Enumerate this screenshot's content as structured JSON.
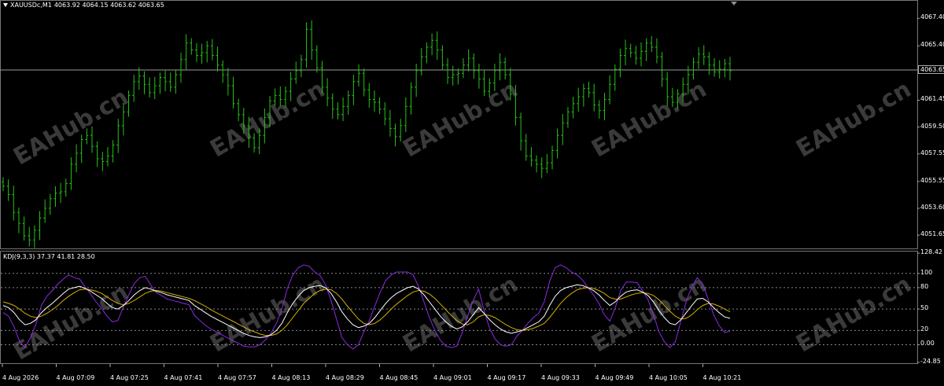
{
  "header": {
    "symbol": "XAUUSDc,M1",
    "ohlc": "4063.92 4064.15 4063.62 4063.65"
  },
  "indicator": {
    "title": "KDJ(9,3,3) 37.37 41.81 28.50"
  },
  "price_axis": {
    "ticks": [
      "4067.40",
      "4065.40",
      "4063.65",
      "4061.45",
      "4059.50",
      "4057.55",
      "4055.55",
      "4053.60",
      "4051.65"
    ],
    "current": "4063.65"
  },
  "indicator_axis": {
    "ticks": [
      "128.42",
      "100",
      "80",
      "50",
      "20",
      "0.00",
      "-24.85"
    ]
  },
  "time_axis": {
    "ticks": [
      "4 Aug 2026",
      "4 Aug 07:09",
      "4 Aug 07:25",
      "4 Aug 07:41",
      "4 Aug 07:57",
      "4 Aug 08:13",
      "4 Aug 08:29",
      "4 Aug 08:45",
      "4 Aug 09:01",
      "4 Aug 09:17",
      "4 Aug 09:33",
      "4 Aug 09:49",
      "4 Aug 10:05",
      "4 Aug 10:21"
    ]
  },
  "watermark": "EAHub.cn",
  "colors": {
    "candle": "#26c217",
    "k_line": "#ffffff",
    "d_line": "#d4b000",
    "j_line": "#8a2be2",
    "grid": "#888888"
  },
  "chart_data": {
    "type": "line",
    "price_range": [
      4050.8,
      4068.5
    ],
    "closes": [
      4055.2,
      4054.6,
      4053.3,
      4052.5,
      4051.6,
      4051.3,
      4052.0,
      4052.9,
      4053.6,
      4054.3,
      4054.7,
      4054.8,
      4055.4,
      4056.8,
      4057.6,
      4058.6,
      4058.9,
      4058.1,
      4057.2,
      4057.0,
      4057.4,
      4058.2,
      4059.6,
      4060.6,
      4061.8,
      4062.8,
      4063.2,
      4062.6,
      4062.0,
      4062.5,
      4063.1,
      4062.8,
      4062.4,
      4063.3,
      4064.4,
      4065.6,
      4065.1,
      4064.7,
      4064.9,
      4065.4,
      4064.7,
      4064.0,
      4063.3,
      4062.5,
      4061.2,
      4060.4,
      4059.6,
      4058.7,
      4058.0,
      4058.9,
      4060.2,
      4061.4,
      4061.8,
      4061.5,
      4062.1,
      4063.0,
      4063.6,
      4064.4,
      4066.6,
      4065.1,
      4063.8,
      4062.4,
      4061.6,
      4060.8,
      4060.4,
      4061.0,
      4061.8,
      4062.8,
      4063.4,
      4062.2,
      4061.5,
      4061.3,
      4060.8,
      4060.1,
      4059.4,
      4058.8,
      4059.6,
      4061.0,
      4062.4,
      4063.6,
      4064.6,
      4065.3,
      4065.8,
      4065.1,
      4064.0,
      4063.1,
      4063.3,
      4063.4,
      4064.0,
      4064.5,
      4063.6,
      4063.0,
      4062.1,
      4062.7,
      4063.6,
      4064.2,
      4063.3,
      4061.9,
      4060.2,
      4058.5,
      4057.4,
      4057.1,
      4056.8,
      4056.5,
      4056.9,
      4057.8,
      4058.9,
      4059.8,
      4060.6,
      4061.2,
      4061.7,
      4062.3,
      4062.0,
      4061.1,
      4060.7,
      4061.5,
      4062.6,
      4063.7,
      4064.7,
      4065.2,
      4064.9,
      4064.5,
      4065.0,
      4065.6,
      4065.3,
      4064.6,
      4063.0,
      4061.7,
      4061.3,
      4061.9,
      4062.6,
      4063.3,
      4064.2,
      4064.8,
      4064.6,
      4064.0,
      4063.5,
      4063.7,
      4064.1,
      4063.6
    ],
    "k_values": [
      55,
      52,
      45,
      35,
      28,
      30,
      35,
      45,
      52,
      58,
      65,
      72,
      78,
      80,
      82,
      79,
      75,
      70,
      65,
      58,
      52,
      50,
      55,
      62,
      70,
      76,
      80,
      78,
      75,
      73,
      70,
      68,
      66,
      64,
      62,
      55,
      50,
      45,
      40,
      36,
      32,
      28,
      24,
      20,
      16,
      13,
      11,
      10,
      11,
      14,
      20,
      30,
      45,
      58,
      68,
      76,
      80,
      82,
      83,
      80,
      72,
      60,
      46,
      36,
      28,
      24,
      26,
      30,
      38,
      48,
      58,
      66,
      72,
      76,
      80,
      82,
      78,
      70,
      60,
      50,
      40,
      32,
      26,
      22,
      25,
      32,
      42,
      52,
      44,
      35,
      28,
      22,
      18,
      16,
      18,
      20,
      24,
      28,
      32,
      40,
      55,
      68,
      76,
      80,
      82,
      84,
      83,
      80,
      76,
      70,
      62,
      55,
      60,
      68,
      74,
      76,
      77,
      74,
      69,
      60,
      48,
      38,
      30,
      28,
      35,
      45,
      55,
      64,
      65,
      60,
      52,
      45,
      39,
      37
    ],
    "d_values": [
      60,
      58,
      55,
      50,
      44,
      40,
      38,
      40,
      44,
      49,
      55,
      62,
      68,
      73,
      77,
      78,
      77,
      75,
      72,
      67,
      62,
      58,
      56,
      58,
      62,
      67,
      72,
      75,
      76,
      75,
      73,
      71,
      69,
      67,
      65,
      62,
      58,
      54,
      49,
      45,
      41,
      37,
      33,
      29,
      25,
      21,
      18,
      15,
      13,
      13,
      15,
      20,
      28,
      38,
      48,
      58,
      65,
      72,
      76,
      78,
      77,
      72,
      64,
      54,
      45,
      36,
      30,
      28,
      30,
      35,
      42,
      50,
      57,
      63,
      69,
      74,
      76,
      75,
      71,
      65,
      57,
      49,
      41,
      34,
      29,
      28,
      32,
      39,
      42,
      41,
      38,
      33,
      28,
      24,
      21,
      20,
      21,
      23,
      26,
      30,
      38,
      48,
      58,
      66,
      72,
      77,
      79,
      80,
      79,
      76,
      72,
      66,
      64,
      64,
      67,
      70,
      72,
      73,
      72,
      69,
      63,
      55,
      47,
      40,
      36,
      37,
      42,
      49,
      55,
      58,
      57,
      54,
      50,
      46
    ],
    "j_values": [
      45,
      40,
      25,
      5,
      -4,
      10,
      29,
      55,
      68,
      76,
      85,
      92,
      98,
      94,
      92,
      81,
      71,
      60,
      51,
      40,
      32,
      34,
      53,
      70,
      86,
      94,
      96,
      84,
      73,
      69,
      64,
      62,
      60,
      58,
      56,
      41,
      34,
      27,
      22,
      18,
      14,
      10,
      6,
      2,
      -2,
      -3,
      -3,
      0,
      7,
      16,
      30,
      50,
      79,
      98,
      108,
      112,
      110,
      102,
      97,
      84,
      62,
      36,
      10,
      0,
      -6,
      0,
      18,
      34,
      54,
      74,
      90,
      98,
      102,
      102,
      102,
      98,
      82,
      60,
      38,
      20,
      6,
      -2,
      -4,
      -2,
      17,
      40,
      62,
      78,
      48,
      23,
      8,
      0,
      -2,
      0,
      12,
      20,
      30,
      38,
      44,
      60,
      89,
      108,
      112,
      108,
      102,
      98,
      91,
      80,
      70,
      58,
      42,
      33,
      52,
      76,
      88,
      88,
      87,
      76,
      63,
      42,
      18,
      4,
      -4,
      4,
      33,
      61,
      81,
      94,
      85,
      64,
      42,
      27,
      17,
      19
    ]
  }
}
